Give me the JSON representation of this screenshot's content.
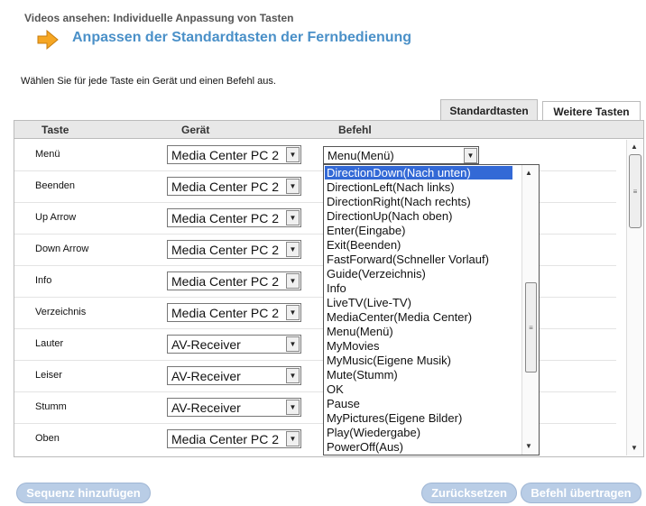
{
  "breadcrumb": "Videos ansehen: Individuelle Anpassung von Tasten",
  "page_title": "Anpassen der Standardtasten der Fernbedienung",
  "instruction": "Wählen Sie für jede Taste ein Gerät und einen Befehl aus.",
  "tabs": [
    {
      "label": "Standardtasten",
      "active": true
    },
    {
      "label": "Weitere Tasten",
      "active": false
    }
  ],
  "columns": {
    "key": "Taste",
    "device": "Gerät",
    "command": "Befehl"
  },
  "rows": [
    {
      "key": "Menü",
      "device": "Media Center PC 2"
    },
    {
      "key": "Beenden",
      "device": "Media Center PC 2"
    },
    {
      "key": "Up Arrow",
      "device": "Media Center PC 2"
    },
    {
      "key": "Down Arrow",
      "device": "Media Center PC 2"
    },
    {
      "key": "Info",
      "device": "Media Center PC 2"
    },
    {
      "key": "Verzeichnis",
      "device": "Media Center PC 2"
    },
    {
      "key": "Lauter",
      "device": "AV-Receiver"
    },
    {
      "key": "Leiser",
      "device": "AV-Receiver"
    },
    {
      "key": "Stumm",
      "device": "AV-Receiver"
    },
    {
      "key": "Oben",
      "device": "Media Center PC 2"
    }
  ],
  "command_select": {
    "value": "Menu(Menü)"
  },
  "command_options": [
    "DirectionDown(Nach unten)",
    "DirectionLeft(Nach links)",
    "DirectionRight(Nach rechts)",
    "DirectionUp(Nach oben)",
    "Enter(Eingabe)",
    "Exit(Beenden)",
    "FastForward(Schneller Vorlauf)",
    "Guide(Verzeichnis)",
    "Info",
    "LiveTV(Live-TV)",
    "MediaCenter(Media Center)",
    "Menu(Menü)",
    "MyMovies",
    "MyMusic(Eigene Musik)",
    "Mute(Stumm)",
    "OK",
    "Pause",
    "MyPictures(Eigene Bilder)",
    "Play(Wiedergabe)",
    "PowerOff(Aus)"
  ],
  "highlighted_option": "DirectionDown(Nach unten)",
  "buttons": {
    "add_sequence": "Sequenz hinzufügen",
    "reset": "Zurücksetzen",
    "apply": "Befehl übertragen"
  },
  "colors": {
    "title": "#4a90c8",
    "selection": "#3369d6",
    "button": "#b9cde6",
    "arrow": "#f5a623"
  },
  "icons": {
    "title_arrow": "arrow-right-icon",
    "dropdown": "chevron-down-icon"
  }
}
